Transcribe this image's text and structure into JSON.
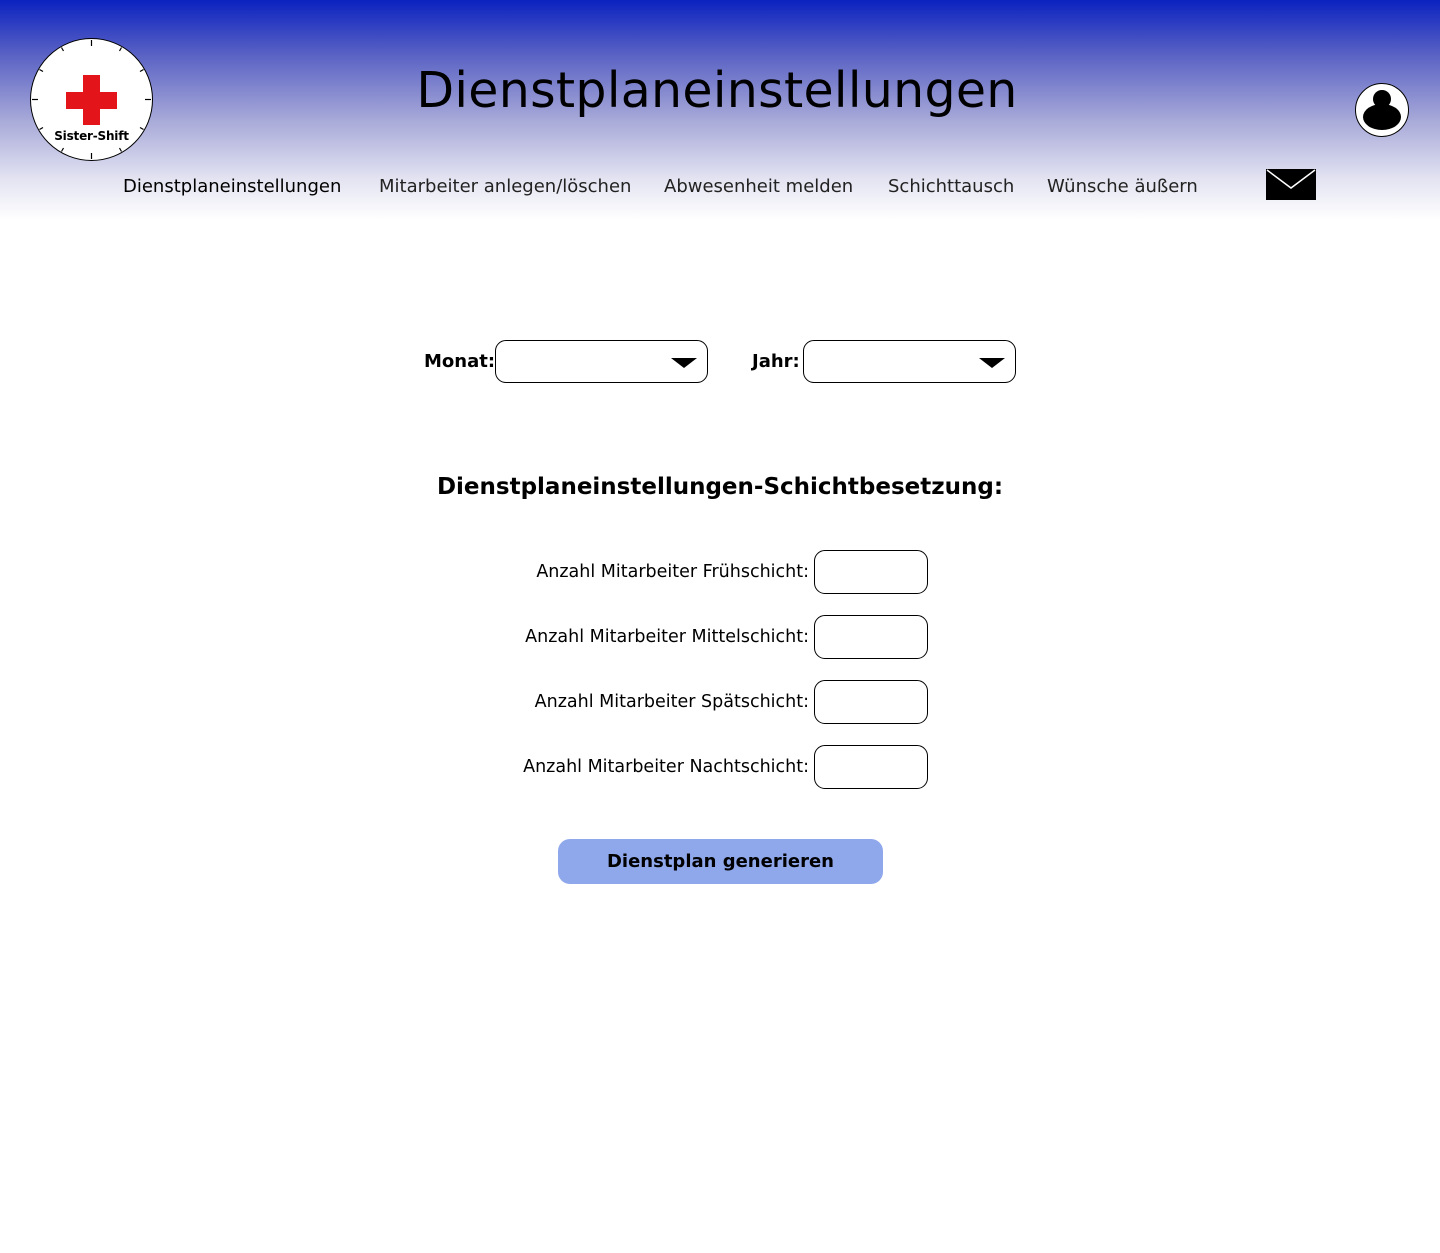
{
  "header": {
    "logo_text": "Sister-Shift",
    "title": "Dienstplaneinstellungen"
  },
  "nav": {
    "items": [
      {
        "label": "Dienstplaneinstellungen",
        "active": true
      },
      {
        "label": "Mitarbeiter anlegen/löschen",
        "active": false
      },
      {
        "label": "Abwesenheit melden",
        "active": false
      },
      {
        "label": "Schichttausch",
        "active": false
      },
      {
        "label": "Wünsche äußern",
        "active": false
      }
    ]
  },
  "period": {
    "month_label": "Monat:",
    "month_value": "",
    "year_label": "Jahr:",
    "year_value": ""
  },
  "staffing": {
    "title": "Dienstplaneinstellungen-Schichtbesetzung:",
    "fields": [
      {
        "label": "Anzahl Mitarbeiter Frühschicht:",
        "value": ""
      },
      {
        "label": "Anzahl Mitarbeiter Mittelschicht:",
        "value": ""
      },
      {
        "label": "Anzahl Mitarbeiter Spätschicht:",
        "value": ""
      },
      {
        "label": "Anzahl Mitarbeiter Nachtschicht:",
        "value": ""
      }
    ]
  },
  "actions": {
    "generate_label": "Dienstplan generieren"
  },
  "colors": {
    "header_top": "#0b22c0",
    "button_bg": "#8fa8ec",
    "logo_cross": "#e3151b"
  }
}
